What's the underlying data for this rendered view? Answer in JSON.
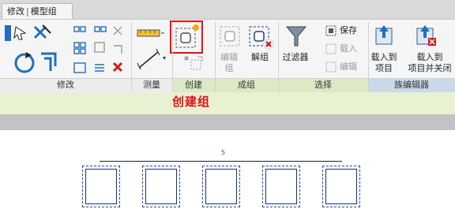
{
  "tab": {
    "left": "修改",
    "right": "模型组"
  },
  "ribbon": {
    "tools": {
      "edit_group": "编辑\n组",
      "ungroup": "解组",
      "filter": "过滤器",
      "save": "保存",
      "load": "载入",
      "edit": "编辑",
      "load_project": "载入到\n项目",
      "load_close": "载入到\n项目并关闭"
    },
    "panels": {
      "modify": "修改",
      "measure": "测量",
      "create": "创建",
      "group": "成组",
      "select": "选择",
      "family_editor": "族编辑器"
    }
  },
  "annotation": {
    "create_group": "创建组"
  },
  "canvas": {
    "dimension_value": "5",
    "box_count": 5
  },
  "colors": {
    "accent_red": "#e8101a",
    "panel_green": "#dce9c5",
    "panel_blue": "#c9d9ea"
  }
}
